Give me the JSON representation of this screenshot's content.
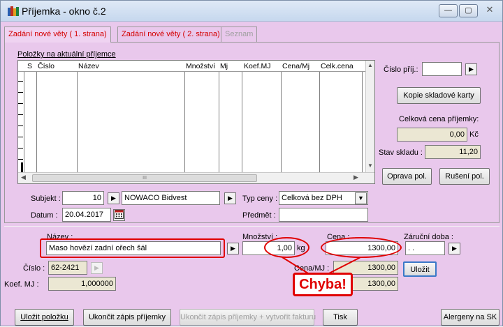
{
  "window": {
    "title": "Příjemka - okno č.2",
    "minimize_glyph": "—",
    "maximize_glyph": "▢",
    "close_glyph": "✕"
  },
  "tabs": [
    {
      "label": "Zadání nové věty ( 1. strana)",
      "active": true
    },
    {
      "label": "Zadání nové věty ( 2. strana)",
      "active": false
    },
    {
      "label": "Seznam",
      "active": false,
      "disabled": true
    }
  ],
  "items_list": {
    "caption": "Položky na aktuální příjemce",
    "columns": [
      "S",
      "Číslo",
      "Název",
      "Množství",
      "Mj",
      "Koef.MJ",
      "Cena/Mj",
      "Celk.cena"
    ],
    "rows": [],
    "scroll_mark": "III"
  },
  "right_panel": {
    "cislo_prij_label": "Číslo příj.:",
    "cislo_prij_value": "",
    "kopie_button": "Kopie skladové karty",
    "celkova_cena_label": "Celková cena příjemky:",
    "celkova_cena_value": "0,00",
    "currency": "Kč",
    "stav_skladu_label": "Stav skladu :",
    "stav_skladu_value": "11,20",
    "oprava_button": "Oprava pol.",
    "zruseni_button": "Rušení pol."
  },
  "header_form": {
    "subjekt_label": "Subjekt :",
    "subjekt_value": "10",
    "subjekt_name": "NOWACO Bidvest",
    "datum_label": "Datum :",
    "datum_value": "20.04.2017",
    "typ_ceny_label": "Typ ceny :",
    "typ_ceny_value": "Celková bez DPH",
    "predmet_label": "Předmět :",
    "predmet_value": ""
  },
  "item_form": {
    "nazev_label": "Název :",
    "nazev_value": "Maso hovězí zadní ořech šál",
    "mnozstvi_label": "Množství :",
    "mnozstvi_value": "1,00",
    "mnozstvi_unit": "kg",
    "cena_label": "Cena :",
    "cena_value": "1300,00",
    "zarucni_doba_label": "Záruční doba :",
    "zarucni_doba_value": ". .",
    "cislo_label": "Číslo :",
    "cislo_value": "62-2421",
    "cena_mj_label": "Cena/MJ :",
    "cena_mj_value": "1300,00",
    "cena2_label": "C",
    "cena2_value": "1300,00",
    "koef_mj_label": "Koef. MJ :",
    "koef_mj_value": "1,000000",
    "ulozit_button": "Uložit"
  },
  "annotation": {
    "text": "Chyba!",
    "color": "#e00000"
  },
  "bottom_buttons": {
    "ulozit_polozku": "Uložit položku",
    "ukoncit_zapis": "Ukončit zápis příjemky",
    "ukoncit_faktura": "Ukončit zápis příjemky + vytvořit fakturu",
    "tisk": "Tisk",
    "alergeny": "Alergeny na SK"
  },
  "colors": {
    "window_bg": "#e9c8ec",
    "active_tab_text": "#d40000",
    "readonly_field": "#ebe7d3"
  }
}
